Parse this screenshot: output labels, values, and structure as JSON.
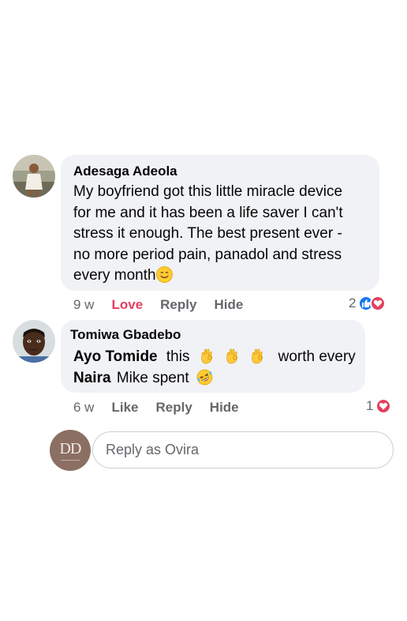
{
  "comments": [
    {
      "author": "Adesaga Adeola",
      "lines": [
        "My boyfriend got this little miracle device",
        "for me and it has been a life saver I can't",
        "stress it enough. The best present ever -",
        "no more period pain, panadol and stress",
        "every month"
      ],
      "emoji": "smiling-face-emoji",
      "time": "9 w",
      "like_label": "Love",
      "reply_label": "Reply",
      "hide_label": "Hide",
      "reaction_count": "2",
      "reactions": [
        "like-icon",
        "love-icon"
      ]
    },
    {
      "author": "Tomiwa Gbadebo",
      "mention_1": "Ayo Tomide",
      "text_1": "this",
      "text_2": "worth every",
      "mention_2": "Naira",
      "text_3": "Mike spent",
      "emojis": [
        "ok-hand-emoji",
        "ok-hand-emoji",
        "ok-hand-emoji",
        "rofl-emoji"
      ],
      "time": "6 w",
      "like_label": "Like",
      "reply_label": "Reply",
      "hide_label": "Hide",
      "reaction_count": "1",
      "reactions": [
        "love-icon"
      ]
    }
  ],
  "reply_box": {
    "placeholder": "Reply as Ovira",
    "avatar_letters": "DD"
  },
  "colors": {
    "bubble": "#f0f2f5",
    "love": "#e4405f",
    "like_blue": "#1877f2",
    "meta_gray": "#65676b",
    "ovira_avatar": "#8b6f62"
  }
}
